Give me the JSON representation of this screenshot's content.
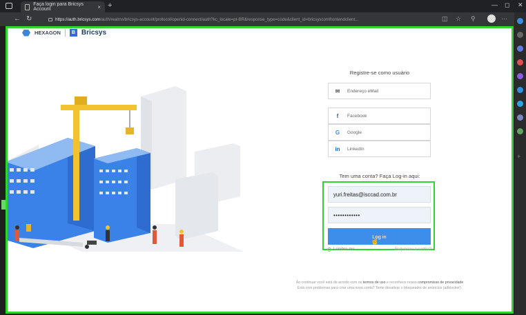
{
  "browser": {
    "tab_title": "Faça login para Bricsys Account",
    "tab_close": "×",
    "new_tab": "+",
    "url_host": "https://auth.bricsys.com",
    "url_path": "/auth/realms/bricsys-account/protocol/openid-connect/auth?kc_locale=pt-BR&response_type=code&client_id=bricsyscomfrontendclient..."
  },
  "brand": {
    "hexagon": "HEXAGON",
    "bricsys": "Bricsys",
    "bricsys_mark": "B"
  },
  "register": {
    "heading": "Registre-se como usuário",
    "email_label": "Endereço eMail",
    "facebook_label": "Facebook",
    "google_label": "Google",
    "linkedin_label": "LinkedIn",
    "email_icon": "✉",
    "facebook_icon": "f",
    "google_icon": "G",
    "linkedin_icon": "in"
  },
  "login": {
    "heading": "Tem uma conta? Faça Log-in aqui:",
    "email_value": "yuri.freitas@isccad.com.br",
    "password_value": "••••••••••••",
    "button_label": "Log in",
    "remember_label": "Lembre-me",
    "forgot_label": "Esqueceu a senha?"
  },
  "legal": {
    "line1_prefix": "Ao continuar você está de acordo com os ",
    "terms": "termos de uso",
    "line1_mid": " e reconhece nosso ",
    "privacy": "compromisso de privacidade",
    "line2": "Está com problemas para criar uma nova conta? Tente desativar o bloqueador de anúncios (adblocker)."
  },
  "colors": {
    "highlight": "#2fd42f",
    "login_button": "#3d8eea",
    "building_blue": "#3b82e8",
    "crane": "#f2c230"
  }
}
